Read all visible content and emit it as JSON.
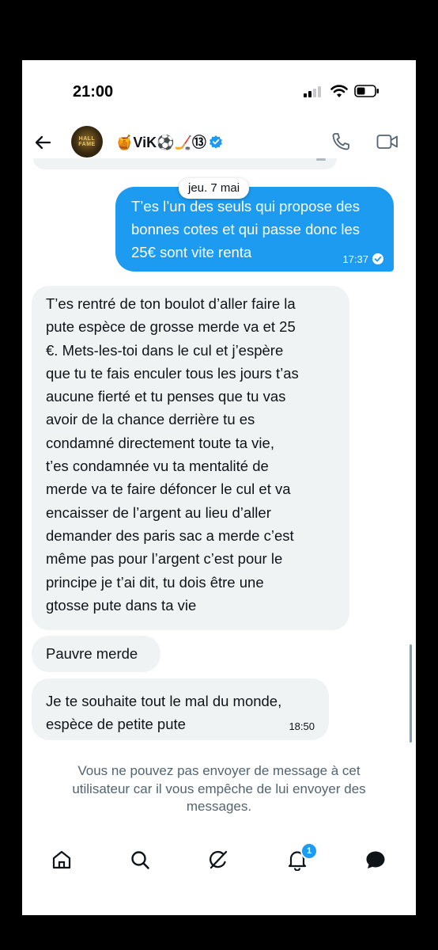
{
  "status_bar": {
    "time": "21:00"
  },
  "header": {
    "avatar_text": "HALL FAME",
    "contact_name": "🍯ViK⚽️🏒⑬",
    "verified": true
  },
  "thread": {
    "date_separator": "jeu. 7 mai",
    "outgoing": [
      {
        "lines": [
          "T’es l’un des seuls qui propose des",
          "bonnes cotes et qui passe donc les",
          "25€ sont vite renta"
        ],
        "time": "17:37",
        "status": "read"
      }
    ],
    "incoming_long": {
      "lines": [
        "T’es rentré de ton boulot d’aller faire la",
        "pute espèce de grosse merde va et 25",
        "€. Mets-les-toi dans le cul et j’espère",
        "que tu te fais enculer tous les jours t’as",
        "aucune fierté et tu penses que tu vas",
        "avoir de la chance derrière tu es",
        "condamné directement toute ta vie,",
        "t’es condamnée vu ta mentalité de",
        "merde va te faire défoncer le cul et va",
        "encaisser de l’argent au lieu d’aller",
        "demander des paris sac a merde c’est",
        "même pas pour l’argent c’est pour le",
        "principe je t’ai dit, tu dois être une",
        "gtosse pute dans ta vie"
      ]
    },
    "incoming_short": {
      "text": "Pauvre merde"
    },
    "incoming_last": {
      "lines": [
        "Je te souhaite tout le mal du monde,",
        "espèce de petite pute"
      ],
      "time": "18:50"
    },
    "blocked_notice": [
      "Vous ne pouvez pas envoyer de message à cet",
      "utilisateur car il vous empêche de lui envoyer des",
      "messages."
    ]
  },
  "tab_bar": {
    "items": [
      "home-icon",
      "search-icon",
      "grok-icon",
      "notifications-icon",
      "messages-icon"
    ],
    "notifications_badge": "1"
  },
  "colors": {
    "accent": "#1d9bf0",
    "incoming_bubble": "#eff3f4",
    "muted_text": "#536471"
  }
}
